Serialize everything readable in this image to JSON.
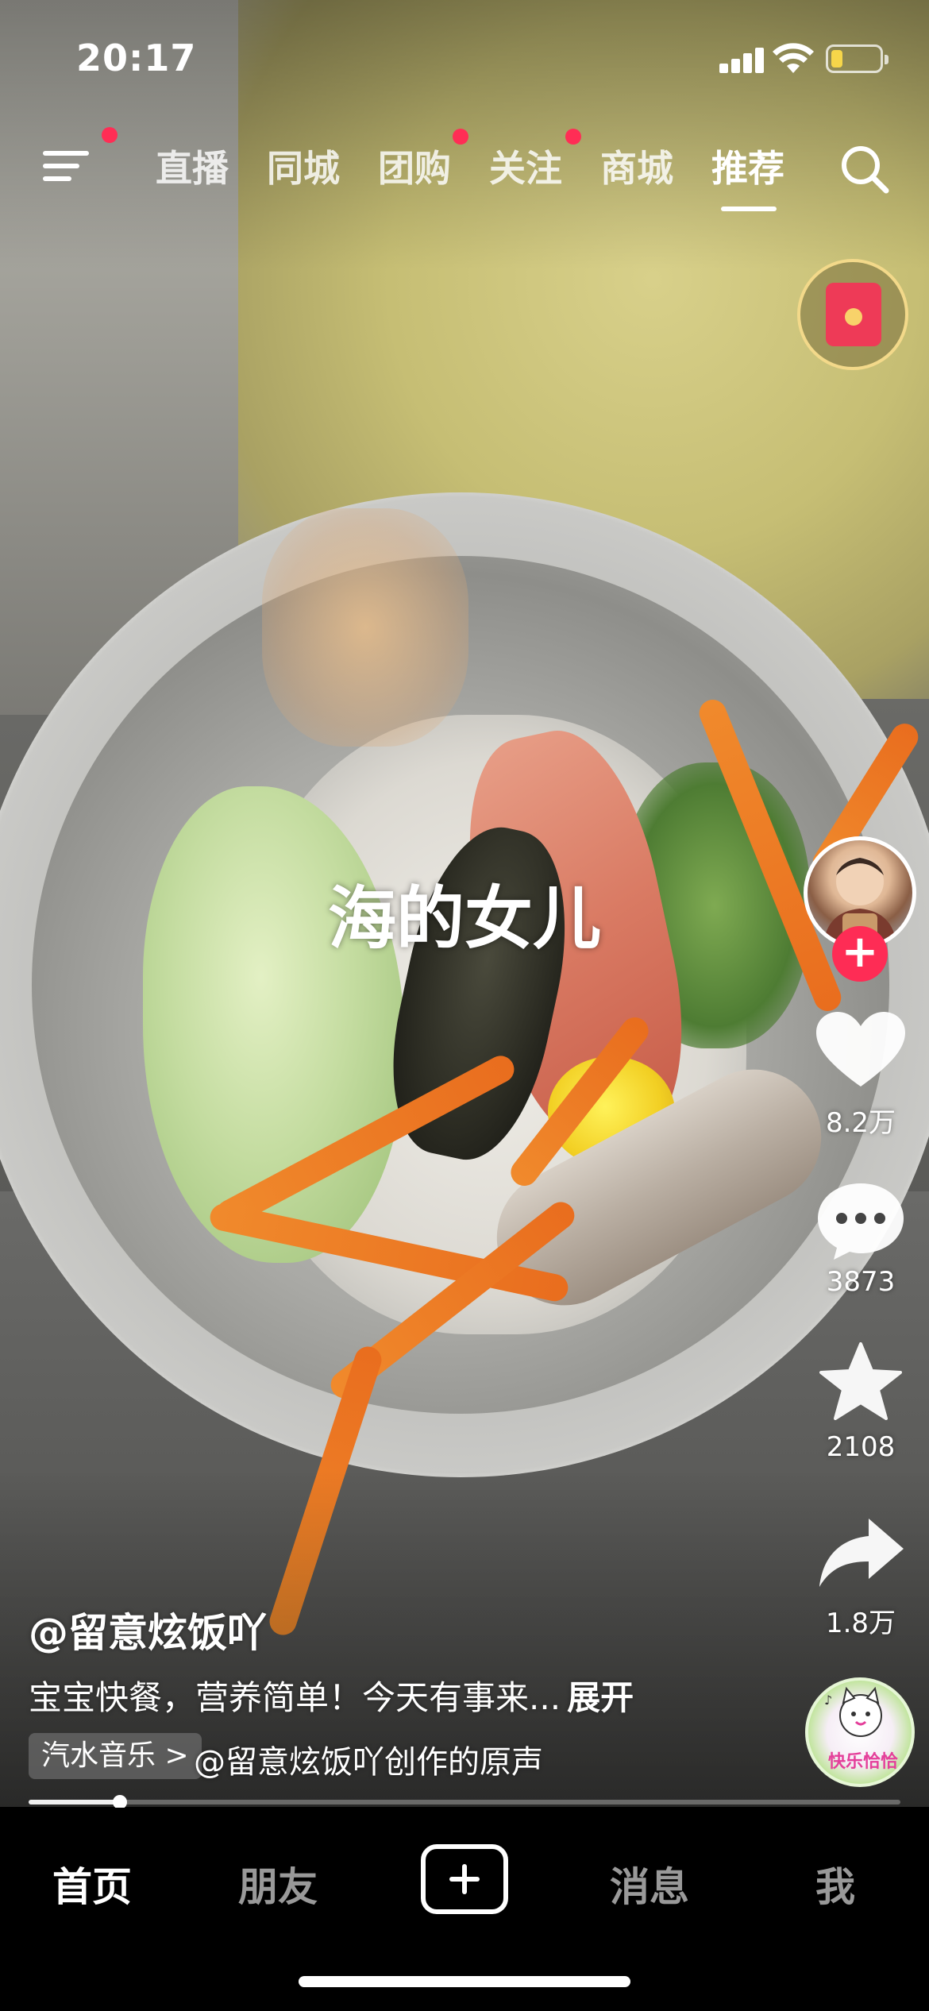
{
  "status_bar": {
    "time": "20:17",
    "icons": [
      "cellular-signal-icon",
      "wifi-icon",
      "battery-low-icon"
    ],
    "battery_color": "#f6d64a"
  },
  "top_nav": {
    "menu_icon": "menu-icon",
    "tabs": [
      {
        "label": "直播",
        "has_dot": false
      },
      {
        "label": "同城",
        "has_dot": false
      },
      {
        "label": "团购",
        "has_dot": true
      },
      {
        "label": "关注",
        "has_dot": true
      },
      {
        "label": "商城",
        "has_dot": false
      },
      {
        "label": "推荐",
        "has_dot": false,
        "active": true
      }
    ],
    "search_icon": "search-icon",
    "dot_color": "#ff2d55"
  },
  "widget": {
    "icon": "red-packet-icon"
  },
  "video": {
    "overlay_title": "海的女儿"
  },
  "right_rail": {
    "follow_label": "+",
    "like_count": "8.2万",
    "comment_count": "3873",
    "favorite_count": "2108",
    "share_count": "1.8万",
    "music_disc_label": "快乐恰恰"
  },
  "post": {
    "author": "@留意炫饭吖",
    "caption": "宝宝快餐，营养简单！今天有事来...",
    "expand_label": "展开",
    "music_tag": "汽水音乐 >",
    "music_text": "@留意炫饭吖创作的原声"
  },
  "playback": {
    "progress": 0.105
  },
  "tab_bar": {
    "home": "首页",
    "friends": "朋友",
    "create_icon": "plus-icon",
    "messages": "消息",
    "me": "我"
  },
  "colors": {
    "accent": "#fe2c55",
    "background": "#000000"
  }
}
